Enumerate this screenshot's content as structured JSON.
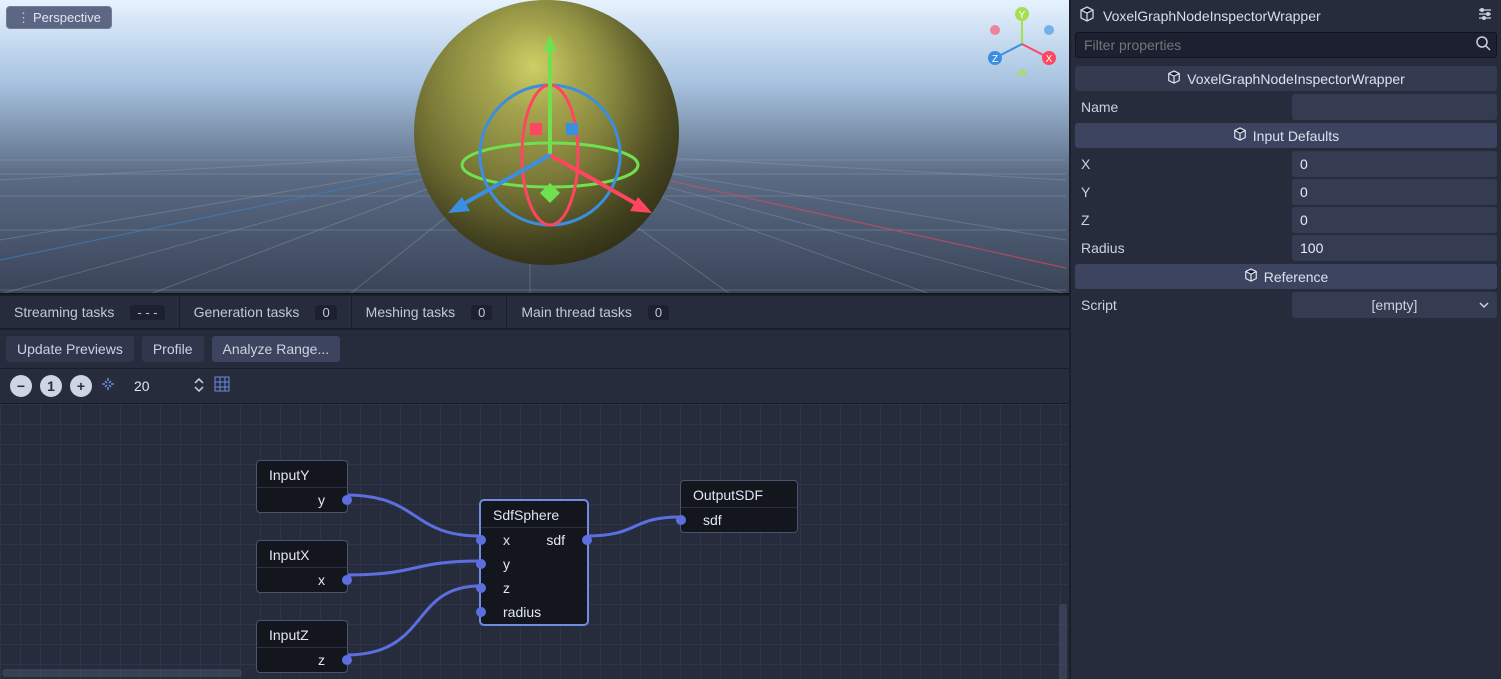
{
  "viewport": {
    "perspective_label": "Perspective",
    "axis_labels": {
      "x": "X",
      "y": "Y",
      "z": "Z"
    }
  },
  "status": {
    "streaming_label": "Streaming tasks",
    "streaming_value": "- - -",
    "generation_label": "Generation tasks",
    "generation_value": "0",
    "meshing_label": "Meshing tasks",
    "meshing_value": "0",
    "mainthread_label": "Main thread tasks",
    "mainthread_value": "0"
  },
  "toolbar": {
    "update_previews": "Update Previews",
    "profile": "Profile",
    "analyze_range": "Analyze Range..."
  },
  "graph_toolbar": {
    "zoom": "20"
  },
  "graph": {
    "nodes": {
      "input_y": {
        "title": "InputY",
        "out": "y"
      },
      "input_x": {
        "title": "InputX",
        "out": "x"
      },
      "input_z": {
        "title": "InputZ",
        "out": "z"
      },
      "sdf_sphere": {
        "title": "SdfSphere",
        "in": [
          "x",
          "y",
          "z",
          "radius"
        ],
        "out": "sdf"
      },
      "output_sdf": {
        "title": "OutputSDF",
        "in": "sdf"
      }
    }
  },
  "inspector": {
    "class_title": "VoxelGraphNodeInspectorWrapper",
    "filter_placeholder": "Filter properties",
    "class_header": "VoxelGraphNodeInspectorWrapper",
    "name_label": "Name",
    "name_value": "",
    "input_defaults_header": "Input Defaults",
    "x_label": "X",
    "x_value": "0",
    "y_label": "Y",
    "y_value": "0",
    "z_label": "Z",
    "z_value": "0",
    "radius_label": "Radius",
    "radius_value": "100",
    "reference_header": "Reference",
    "script_label": "Script",
    "script_value": "[empty]"
  },
  "chart_data": null
}
